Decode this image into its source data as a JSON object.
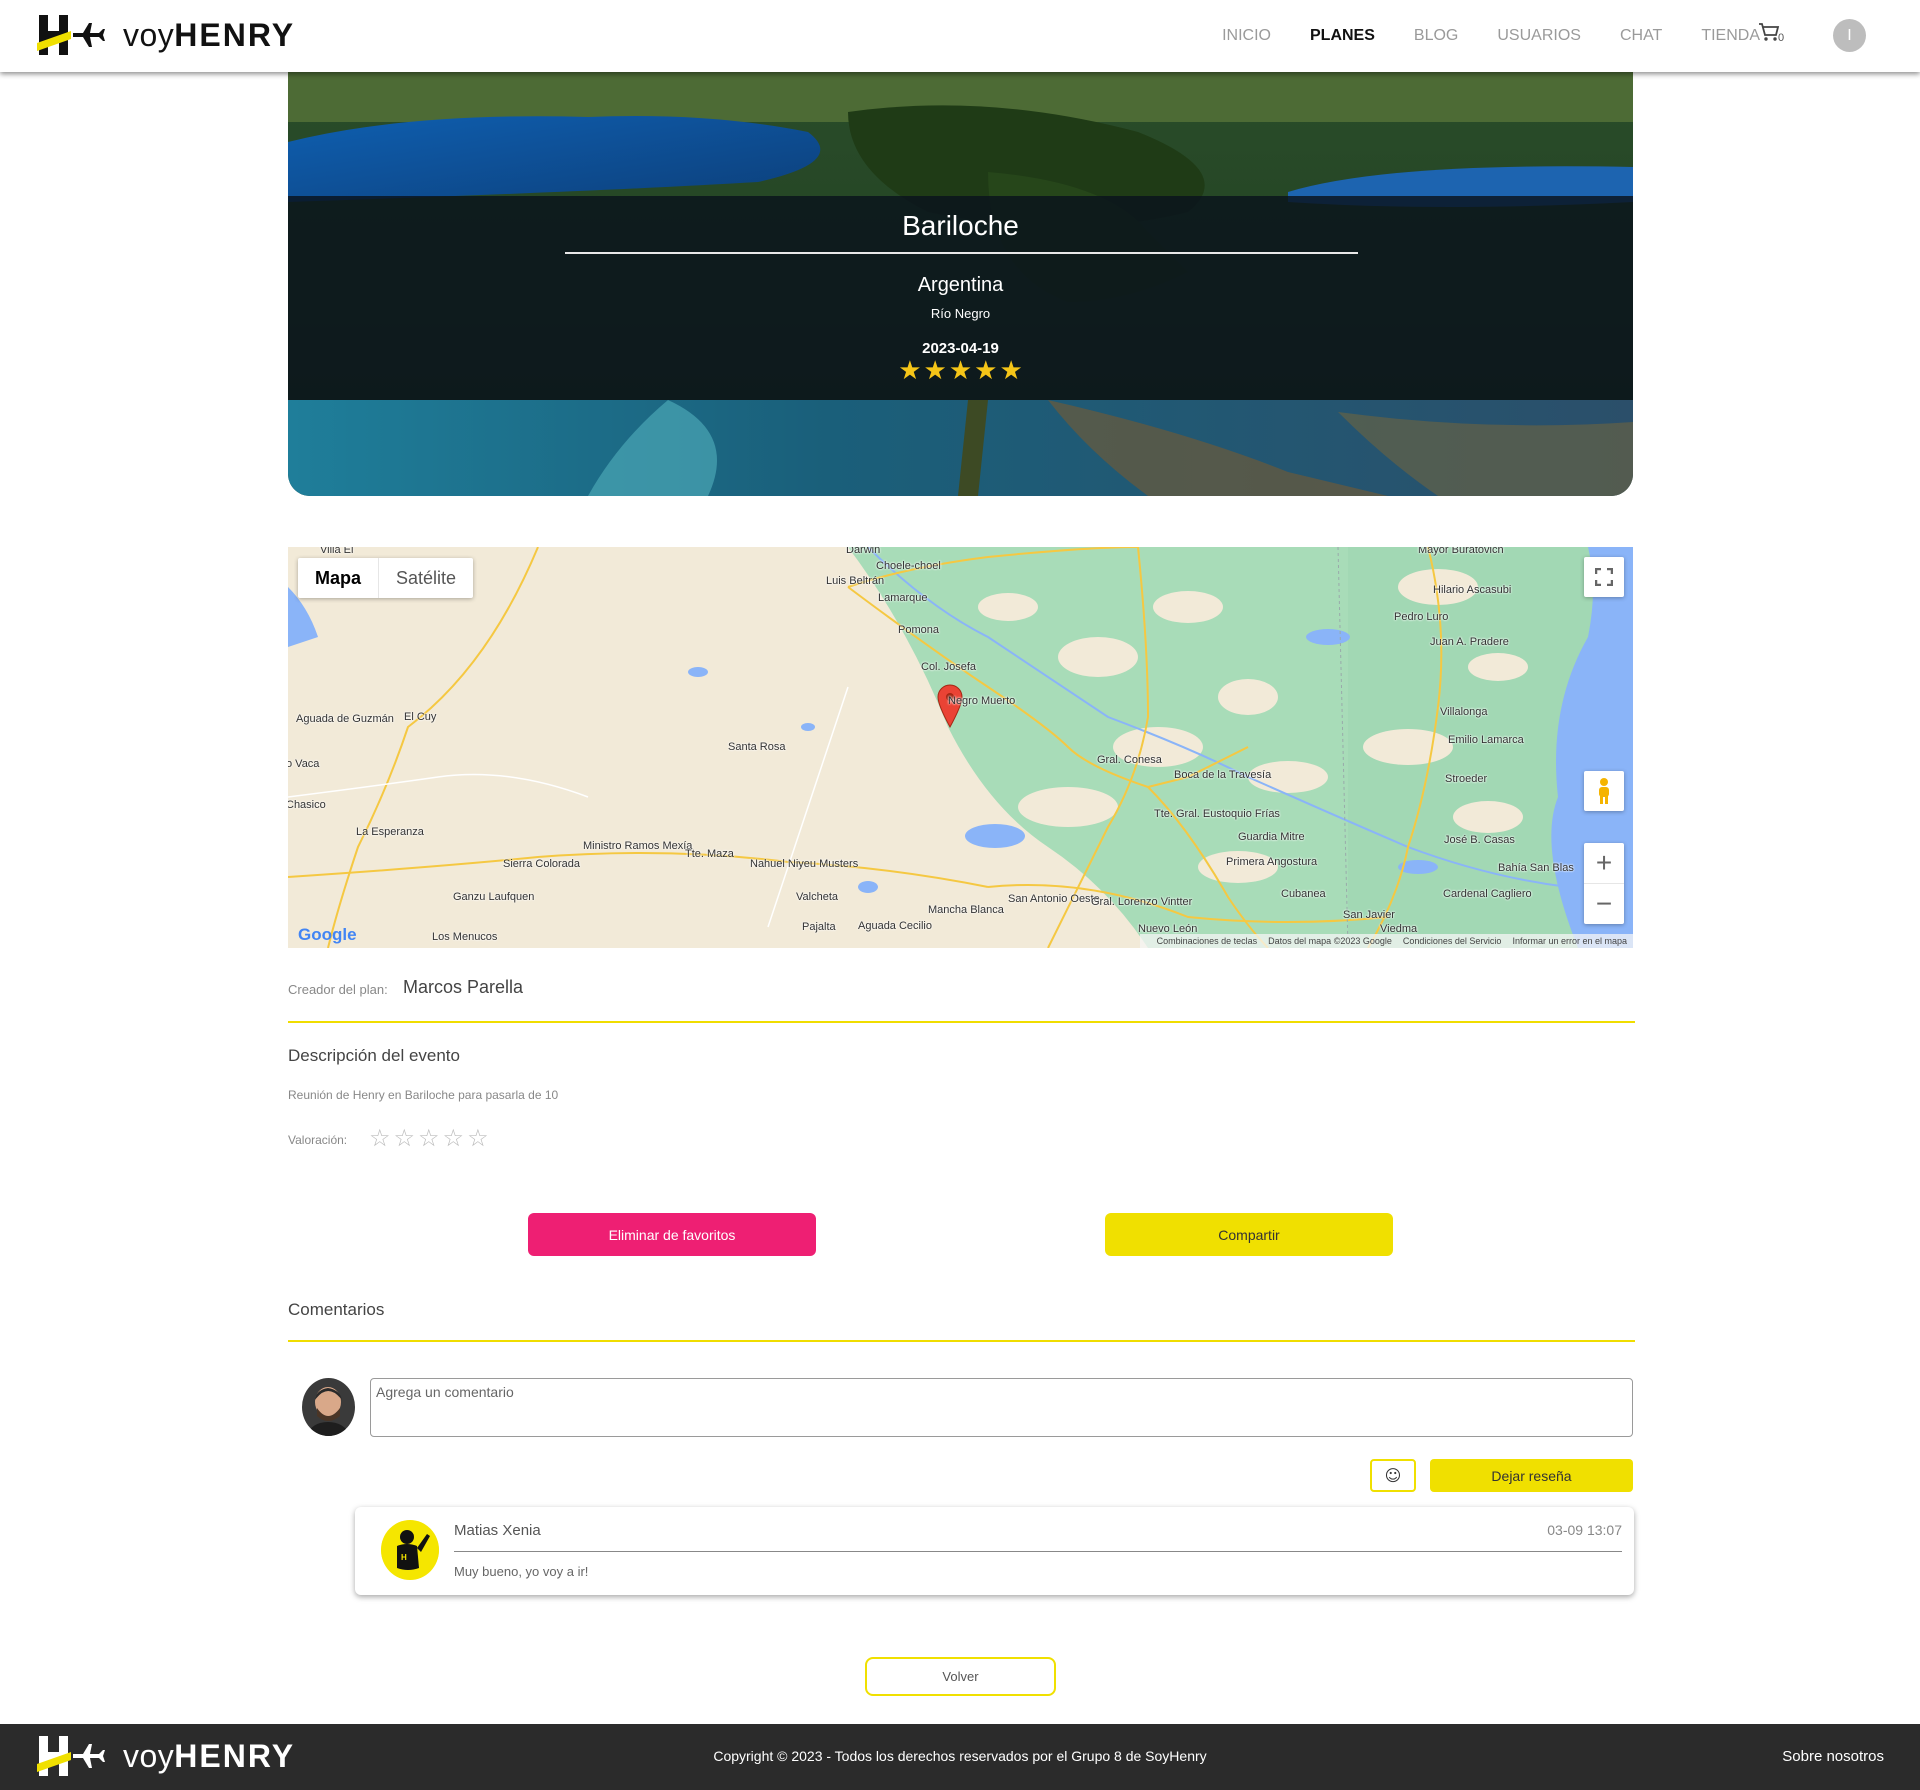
{
  "navbar": {
    "logo_prefix": "voy",
    "logo_brand": "HENRY",
    "links": [
      "INICIO",
      "PLANES",
      "BLOG",
      "USUARIOS",
      "CHAT",
      "TIENDA"
    ],
    "active_link": "PLANES",
    "cart_count": "0",
    "avatar_initial": "I"
  },
  "hero": {
    "title": "Bariloche",
    "country": "Argentina",
    "province": "Río Negro",
    "date": "2023-04-19",
    "stars": 5
  },
  "map": {
    "toggle_map": "Mapa",
    "toggle_satellite": "Satélite",
    "google": "Google",
    "footer": [
      "Combinaciones de teclas",
      "Datos del mapa ©2023 Google",
      "Condiciones del Servicio",
      "Informar un error en el mapa"
    ],
    "places": [
      "Villa El",
      "Darwin",
      "Choele-choel",
      "Luis Beltrán",
      "Lamarque",
      "Pomona",
      "Col. Josefa",
      "Negro Muerto",
      "Mayor Buratovich",
      "Hilario Ascasubi",
      "Pedro Luro",
      "Juan A. Pradere",
      "Villalonga",
      "Emilio Lamarca",
      "Stroeder",
      "Aguada de Guzmán",
      "El Cuy",
      "Santa Rosa",
      "Gral. Conesa",
      "Boca de la Travesía",
      "o Vaca",
      "Chasico",
      "La Esperanza",
      "Ministro Ramos Mexía",
      "Tte. Maza",
      "Sierra Colorada",
      "Nahuel Niyeu Musters",
      "Tte. Gral. Eustoquio Frías",
      "Guardia Mitre",
      "José B. Casas",
      "Primera Angostura",
      "Bahía San Blas",
      "Ganzu Laufquen",
      "Valcheta",
      "Cubanea",
      "Cardenal Cagliero",
      "Mancha Blanca",
      "San Antonio Oeste",
      "Gral. Lorenzo Vintter",
      "San Javier",
      "Pajalta",
      "Aguada Cecilio",
      "Los Menucos",
      "Viedma",
      "Nuevo León"
    ]
  },
  "details": {
    "creator_label": "Creador del plan:",
    "creator_name": "Marcos Parella",
    "desc_title": "Descripción del evento",
    "desc_text": "Reunión de Henry en Bariloche para pasarla de 10",
    "rating_label": "Valoración:",
    "rating_value": 0,
    "rating_max": 5
  },
  "actions": {
    "remove_favorite": "Eliminar de favoritos",
    "share": "Compartir"
  },
  "comments": {
    "title": "Comentarios",
    "input_placeholder": "Agrega un comentario",
    "emoji_icon": "☺",
    "submit": "Dejar reseña",
    "items": [
      {
        "author": "Matias Xenia",
        "time": "03-09 13:07",
        "text": "Muy bueno, yo voy a ir!"
      }
    ]
  },
  "back_button": "Volver",
  "footer": {
    "logo_prefix": "voy",
    "logo_brand": "HENRY",
    "copyright": "Copyright © 2023 - Todos los derechos reservados por el Grupo 8 de SoyHenry",
    "about": "Sobre nosotros"
  },
  "colors": {
    "accent_yellow": "#f0e000",
    "pink": "#ee1f73",
    "footer_bg": "#2b2b2b",
    "star_gold": "#f5c518"
  }
}
